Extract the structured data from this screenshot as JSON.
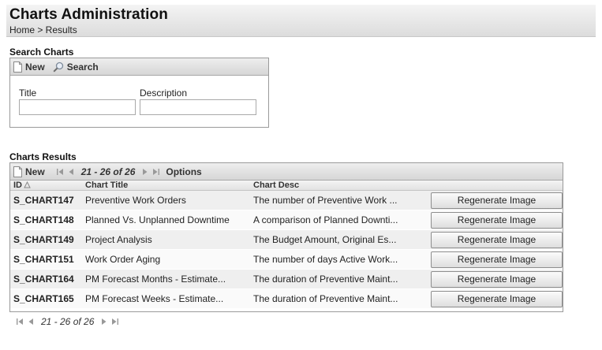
{
  "header": {
    "title": "Charts Administration",
    "breadcrumb": "Home > Results"
  },
  "search": {
    "section_title": "Search Charts",
    "new_label": "New",
    "search_label": "Search",
    "title_label": "Title",
    "title_value": "",
    "description_label": "Description",
    "description_value": ""
  },
  "results": {
    "section_title": "Charts Results",
    "new_label": "New",
    "pager_range": "21 - 26 of 26",
    "options_label": "Options",
    "columns": {
      "id": "ID",
      "title": "Chart Title",
      "desc": "Chart Desc"
    },
    "rows": [
      {
        "id": "S_CHART147",
        "title": "Preventive Work Orders",
        "desc": "The number of Preventive Work ...",
        "button": "Regenerate Image"
      },
      {
        "id": "S_CHART148",
        "title": "Planned Vs. Unplanned Downtime",
        "desc": "A comparison of Planned Downti...",
        "button": "Regenerate Image"
      },
      {
        "id": "S_CHART149",
        "title": "Project Analysis",
        "desc": "The Budget Amount, Original Es...",
        "button": "Regenerate Image"
      },
      {
        "id": "S_CHART151",
        "title": "Work Order Aging",
        "desc": "The number of days Active Work...",
        "button": "Regenerate Image"
      },
      {
        "id": "S_CHART164",
        "title": "PM Forecast Months - Estimate...",
        "desc": "The duration of Preventive Maint...",
        "button": "Regenerate Image"
      },
      {
        "id": "S_CHART165",
        "title": "PM Forecast Weeks - Estimate...",
        "desc": "The duration of Preventive Maint...",
        "button": "Regenerate Image"
      }
    ],
    "bottom_pager_range": "21 - 26 of 26"
  }
}
